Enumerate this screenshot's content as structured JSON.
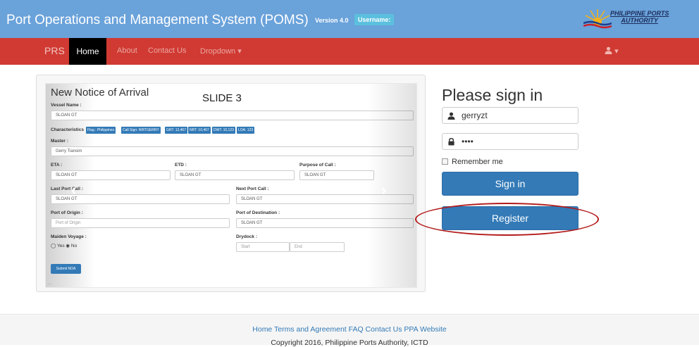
{
  "header": {
    "title": "Port Operations and Management System (POMS)",
    "version": "Version 4.0",
    "username_label": "Username:",
    "logo_text_line1": "PHILIPPINE PORTS",
    "logo_text_line2": "AUTHORITY"
  },
  "navbar": {
    "brand": "PRS",
    "items": [
      "Home",
      "About",
      "Contact Us",
      "Dropdown ▾"
    ],
    "user_menu": "▾"
  },
  "slide": {
    "title": "New Notice of Arrival",
    "slide_label": "SLIDE 3",
    "vessel_name_label": "Vessel Name :",
    "vessel_name_value": "SLOAN GT",
    "characteristics_label": "Characteristics",
    "chips": [
      "Flag : Philippines",
      "Call Sign: WRTGERRY",
      "GRT: 12,467",
      "NRT: 10,467",
      "DWT: 10,123",
      "LOA: 123"
    ],
    "master_label": "Master :",
    "master_value": "Gerry Tiansim",
    "eta_label": "ETA :",
    "eta_value": "SLOAN GT",
    "etd_label": "ETD :",
    "etd_value": "SLOAN GT",
    "purpose_label": "Purpose of Call :",
    "purpose_value": "SLOAN GT",
    "last_port_label": "Last Port Call :",
    "last_port_value": "SLOAN GT",
    "next_port_label": "Next Port Call :",
    "next_port_value": "SLOAN GT",
    "origin_label": "Port of Origin :",
    "origin_placeholder": "Port of Origin",
    "destination_label": "Port of Destination :",
    "destination_value": "SLOAN GT",
    "maiden_label": "Maiden Voyage :",
    "maiden_yes": "Yes",
    "maiden_no": "No",
    "drydock_label": "Drydock :",
    "drydock_start": "Start",
    "drydock_end": "End",
    "submit_label": "Submit NOA",
    "dots": "...",
    "prev_arrow": "‹",
    "next_arrow": "›"
  },
  "signin": {
    "title": "Please sign in",
    "username_value": "gerryzt",
    "password_value": "••••",
    "remember_label": "Remember me",
    "signin_button": "Sign in",
    "register_button": "Register"
  },
  "footer": {
    "links": "Home Terms and Agreement FAQ Contact Us PPA Website",
    "copyright": "Copyright 2016, Philippine Ports Authority, ICTD"
  },
  "colors": {
    "header_bg": "#6aa2da",
    "navbar_bg": "#d03a33",
    "primary": "#337ab7",
    "highlight_ellipse": "#b31b1b"
  }
}
